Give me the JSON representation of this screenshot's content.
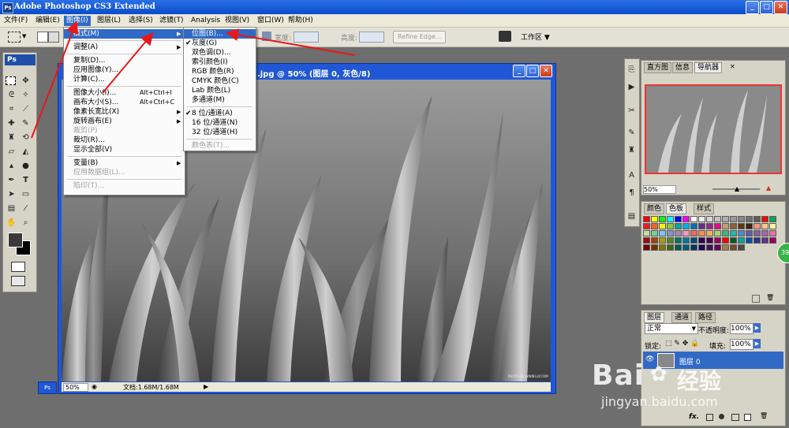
{
  "window": {
    "title": "Adobe Photoshop CS3 Extended",
    "icon": "Ps",
    "buttons": {
      "minimize": "_",
      "maximize": "□",
      "close": "✕"
    }
  },
  "menubar": [
    {
      "label": "文件(F)"
    },
    {
      "label": "编辑(E)"
    },
    {
      "label": "图像(I)"
    },
    {
      "label": "图层(L)"
    },
    {
      "label": "选择(S)"
    },
    {
      "label": "滤镜(T)"
    },
    {
      "label": "Analysis"
    },
    {
      "label": "视图(V)"
    },
    {
      "label": "窗口(W)"
    },
    {
      "label": "帮助(H)"
    }
  ],
  "options_bar": {
    "width_label": "宽度:",
    "height_label": "高度:",
    "refine_edge": "Refine Edge...",
    "workspace": "工作区 ▼"
  },
  "document": {
    "title": ".jpg @ 50% (图层 0, 灰色/8)",
    "zoom": "50%",
    "doc_size": "文档:1.68M/1.68M",
    "credit": "PHOTO BY WWW.LLY.COM"
  },
  "image_menu": {
    "items": [
      {
        "label": "模式(M)",
        "shortcut": "",
        "submenu": true,
        "state": "highlight"
      },
      {
        "sep": true
      },
      {
        "label": "调整(A)",
        "shortcut": "",
        "submenu": true,
        "state": ""
      },
      {
        "sep": true
      },
      {
        "label": "复制(D)...",
        "shortcut": "",
        "submenu": false,
        "state": ""
      },
      {
        "label": "应用图像(Y)...",
        "shortcut": "",
        "submenu": false,
        "state": ""
      },
      {
        "label": "计算(C)...",
        "shortcut": "",
        "submenu": false,
        "state": ""
      },
      {
        "sep": true
      },
      {
        "label": "图像大小(I)...",
        "shortcut": "Alt+Ctrl+I",
        "submenu": false,
        "state": ""
      },
      {
        "label": "画布大小(S)...",
        "shortcut": "Alt+Ctrl+C",
        "submenu": false,
        "state": ""
      },
      {
        "label": "像素长宽比(X)",
        "shortcut": "",
        "submenu": true,
        "state": ""
      },
      {
        "label": "旋转画布(E)",
        "shortcut": "",
        "submenu": true,
        "state": ""
      },
      {
        "label": "裁剪(P)",
        "shortcut": "",
        "submenu": false,
        "state": "disabled"
      },
      {
        "label": "裁切(R)...",
        "shortcut": "",
        "submenu": false,
        "state": ""
      },
      {
        "label": "显示全部(V)",
        "shortcut": "",
        "submenu": false,
        "state": ""
      },
      {
        "sep": true
      },
      {
        "label": "变量(B)",
        "shortcut": "",
        "submenu": true,
        "state": ""
      },
      {
        "label": "应用数据组(L)...",
        "shortcut": "",
        "submenu": false,
        "state": "disabled"
      },
      {
        "sep": true
      },
      {
        "label": "陷印(T)...",
        "shortcut": "",
        "submenu": false,
        "state": "disabled"
      }
    ]
  },
  "mode_submenu": {
    "items": [
      {
        "label": "位图(B)...",
        "check": "",
        "state": "highlight"
      },
      {
        "label": "灰度(G)",
        "check": "✔",
        "state": ""
      },
      {
        "label": "双色调(D)...",
        "check": "",
        "state": ""
      },
      {
        "label": "索引颜色(I)",
        "check": "",
        "state": ""
      },
      {
        "label": "RGB 颜色(R)",
        "check": "",
        "state": ""
      },
      {
        "label": "CMYK 颜色(C)",
        "check": "",
        "state": ""
      },
      {
        "label": "Lab 颜色(L)",
        "check": "",
        "state": ""
      },
      {
        "label": "多通道(M)",
        "check": "",
        "state": ""
      },
      {
        "sep": true
      },
      {
        "label": "8 位/通道(A)",
        "check": "✔",
        "state": ""
      },
      {
        "label": "16 位/通道(N)",
        "check": "",
        "state": ""
      },
      {
        "label": "32 位/通道(H)",
        "check": "",
        "state": ""
      },
      {
        "sep": true
      },
      {
        "label": "颜色表(T)...",
        "check": "",
        "state": "disabled"
      }
    ]
  },
  "navigator_panel": {
    "tabs": [
      "直方图",
      "信息",
      "导航器"
    ],
    "zoom": "50%"
  },
  "color_panel": {
    "tabs": [
      "颜色",
      "色板",
      "样式"
    ],
    "swatch_colors": [
      "#ff0000",
      "#ffff00",
      "#00ff00",
      "#00ffff",
      "#0000ff",
      "#ff00ff",
      "#ffffff",
      "#ebebeb",
      "#d6d6d6",
      "#c2c2c2",
      "#adadad",
      "#999999",
      "#858585",
      "#707070",
      "#5c5c5c",
      "#ff0000",
      "#00a651",
      "#ed1c24",
      "#f26522",
      "#fff200",
      "#8dc63f",
      "#00a99d",
      "#00aeef",
      "#0072bc",
      "#662d91",
      "#92278f",
      "#ec008c",
      "#c69c6d",
      "#8c6239",
      "#603913",
      "#3c2415",
      "#f7977a",
      "#fdc68a",
      "#fff79a",
      "#c4df9b",
      "#82ca9c",
      "#6dcff6",
      "#8393ca",
      "#a187be",
      "#f49ac1",
      "#f26c4f",
      "#f68e56",
      "#fbaf5d",
      "#acd373",
      "#3cb878",
      "#1cbbb4",
      "#448ccb",
      "#605ca8",
      "#855fa8",
      "#a864a8",
      "#f06eaa",
      "#9e0b0f",
      "#a0410d",
      "#aba000",
      "#598527",
      "#00746b",
      "#0076a3",
      "#004a80",
      "#32004b",
      "#4b0049",
      "#9e005d",
      "#ff0000",
      "#005e20",
      "#00a99d",
      "#0054a6",
      "#2e3192",
      "#662d91",
      "#9e005d",
      "#790000",
      "#7b2e00",
      "#827b00",
      "#406618",
      "#005952",
      "#005b7f",
      "#003663",
      "#21005d",
      "#440e62",
      "#630460",
      "#a67c52",
      "#754c24",
      "#534741"
    ]
  },
  "layers_panel": {
    "tabs": [
      "图层",
      "通道",
      "路径"
    ],
    "blend_mode": "正常",
    "opacity_label": "不透明度:",
    "opacity": "100%",
    "lock_label": "锁定:",
    "fill_label": "填充:",
    "fill": "100%",
    "layer_name": "图层 0",
    "fx_label": "fx."
  },
  "watermark": {
    "brand": "Bai",
    "brand2": "经验",
    "url": "jingyan.baidu.com"
  },
  "badge": "39"
}
